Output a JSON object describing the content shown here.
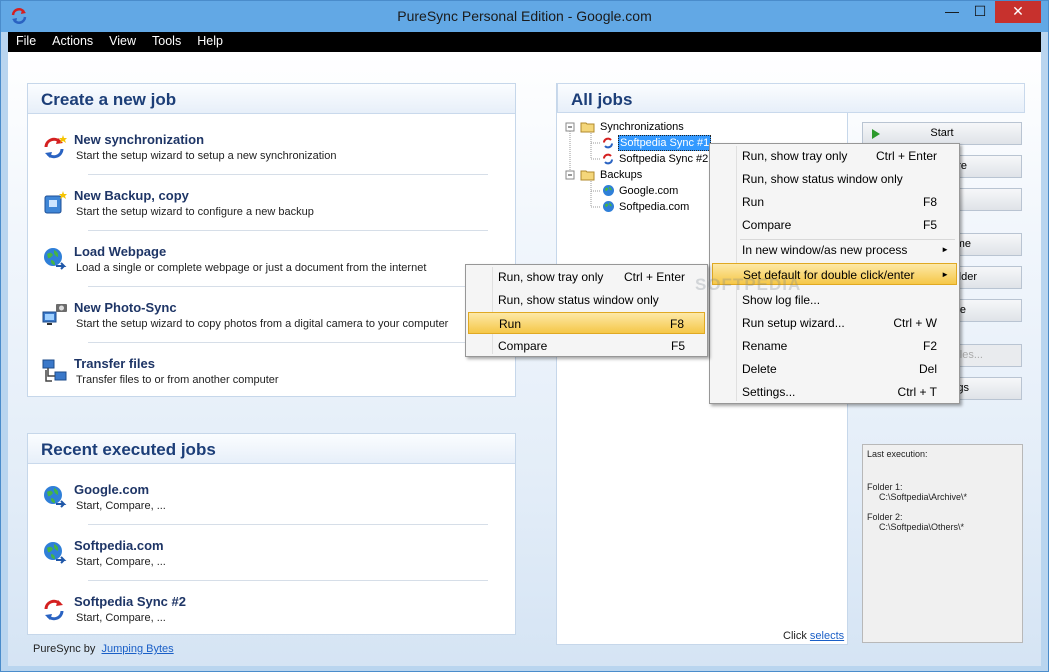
{
  "window": {
    "title": "PureSync Personal Edition  -  Google.com",
    "minimize": "—",
    "maximize": "☐",
    "close": "✕"
  },
  "menu": [
    "File",
    "Actions",
    "View",
    "Tools",
    "Help"
  ],
  "create": {
    "title": "Create a new job",
    "items": [
      {
        "title": "New synchronization",
        "desc": "Start the setup wizard to setup a new synchronization",
        "icon": "new-sync-icon"
      },
      {
        "title": "New Backup, copy",
        "desc": "Start the setup wizard to configure a new backup",
        "icon": "new-backup-icon"
      },
      {
        "title": "Load Webpage",
        "desc": "Load a single or complete webpage or just a document from the internet",
        "icon": "globe-icon"
      },
      {
        "title": "New Photo-Sync",
        "desc": "Start the setup wizard to copy photos from a digital camera to your computer",
        "icon": "camera-icon"
      },
      {
        "title": "Transfer files",
        "desc": "Transfer files to or from another computer",
        "icon": "network-icon"
      }
    ]
  },
  "recent": {
    "title": "Recent executed jobs",
    "items": [
      {
        "title": "Google.com",
        "desc": "Start, Compare, ..."
      },
      {
        "title": "Softpedia.com",
        "desc": "Start, Compare, ..."
      },
      {
        "title": "Softpedia Sync #2",
        "desc": "Start, Compare, ..."
      }
    ]
  },
  "footer": {
    "prefix": "PureSync by",
    "link": "Jumping Bytes"
  },
  "jobs": {
    "title": "All jobs",
    "tree": {
      "sync_group": "Synchronizations",
      "sync1": "Softpedia Sync #1",
      "sync2": "Softpedia Sync #2",
      "backup_group": "Backups",
      "backup1": "Google.com",
      "backup2": "Softpedia.com"
    },
    "click_prefix": "Click",
    "click_link": "selects"
  },
  "buttons": {
    "start": "Start",
    "b2": "re",
    "b4": "me",
    "b5": "lder",
    "b6": "e",
    "b7": "iles...",
    "b8": "gs"
  },
  "info": {
    "last": "Last execution:",
    "f1_label": "Folder 1:",
    "f1_path": "C:\\Softpedia\\Archive\\*",
    "f2_label": "Folder 2:",
    "f2_path": "C:\\Softpedia\\Others\\*"
  },
  "context_main": [
    {
      "label": "Run, show tray only",
      "shortcut": "Ctrl + Enter"
    },
    {
      "label": "Run, show status window only",
      "shortcut": ""
    },
    {
      "label": "Run",
      "shortcut": "F8"
    },
    {
      "label": "Compare",
      "shortcut": "F5"
    },
    {
      "label": "In new window/as new process",
      "shortcut": "►"
    },
    {
      "label": "Set default for double click/enter",
      "shortcut": "►"
    },
    {
      "label": "Show log file...",
      "shortcut": ""
    },
    {
      "label": "Run setup wizard...",
      "shortcut": "Ctrl + W"
    },
    {
      "label": "Rename",
      "shortcut": "F2"
    },
    {
      "label": "Delete",
      "shortcut": "Del"
    },
    {
      "label": "Settings...",
      "shortcut": "Ctrl + T"
    }
  ],
  "context_sub": [
    {
      "label": "Run, show tray only",
      "shortcut": "Ctrl + Enter"
    },
    {
      "label": "Run, show status window only",
      "shortcut": ""
    },
    {
      "label": "Run",
      "shortcut": "F8"
    },
    {
      "label": "Compare",
      "shortcut": "F5"
    }
  ],
  "watermark": "SOFTPEDIA",
  "colors": {
    "accent": "#1c3e78",
    "highlight": "#f5c748",
    "titlebar": "#62a8e5",
    "selection": "#3399ff"
  }
}
